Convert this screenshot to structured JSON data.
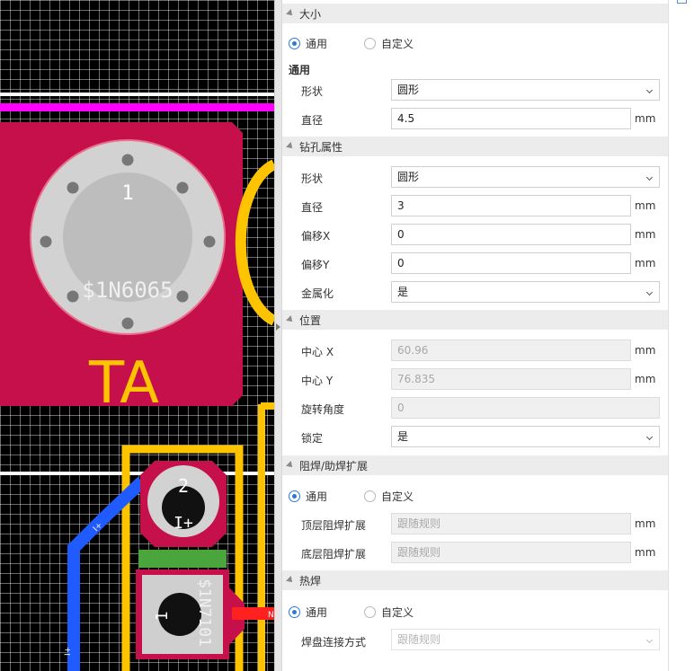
{
  "canvas": {
    "pad1": {
      "number": "1",
      "net": "$1N6065"
    },
    "pad2": {
      "number": "2",
      "net_label": "I+"
    },
    "pad3": {
      "number": "1",
      "net": "$1N7101"
    },
    "silk_text": "TA",
    "trace_label": "I+",
    "trace_label2": "I+",
    "edge_label": "N",
    "colors": {
      "pad_red": "#c5104b",
      "hole_gray": "#d2d2d2",
      "silk_yellow": "#ffc400",
      "magenta": "#ff00ff",
      "trace_blue": "#1f5bff",
      "green": "#4aa63c",
      "edge_red": "#ff2020"
    }
  },
  "panel": {
    "size_section": {
      "title": "大小",
      "radio_general": "通用",
      "radio_custom": "自定义",
      "general_label": "通用",
      "shape_label": "形状",
      "shape_value": "圆形",
      "diameter_label": "直径",
      "diameter_value": "4.5",
      "unit": "mm"
    },
    "drill_section": {
      "title": "钻孔属性",
      "shape_label": "形状",
      "shape_value": "圆形",
      "diameter_label": "直径",
      "diameter_value": "3",
      "offset_x_label": "偏移X",
      "offset_x_value": "0",
      "offset_y_label": "偏移Y",
      "offset_y_value": "0",
      "plated_label": "金属化",
      "plated_value": "是",
      "unit": "mm"
    },
    "position_section": {
      "title": "位置",
      "center_x_label": "中心 X",
      "center_x_value": "60.96",
      "center_y_label": "中心 Y",
      "center_y_value": "76.835",
      "rotation_label": "旋转角度",
      "rotation_value": "0",
      "lock_label": "锁定",
      "lock_value": "是",
      "unit": "mm"
    },
    "mask_section": {
      "title": "阻焊/助焊扩展",
      "radio_general": "通用",
      "radio_custom": "自定义",
      "top_label": "顶层阻焊扩展",
      "top_value": "跟随规则",
      "bottom_label": "底层阻焊扩展",
      "bottom_value": "跟随规则",
      "unit": "mm"
    },
    "thermal_section": {
      "title": "热焊",
      "radio_general": "通用",
      "radio_custom": "自定义",
      "connection_label": "焊盘连接方式",
      "connection_value": "跟随规则"
    }
  }
}
